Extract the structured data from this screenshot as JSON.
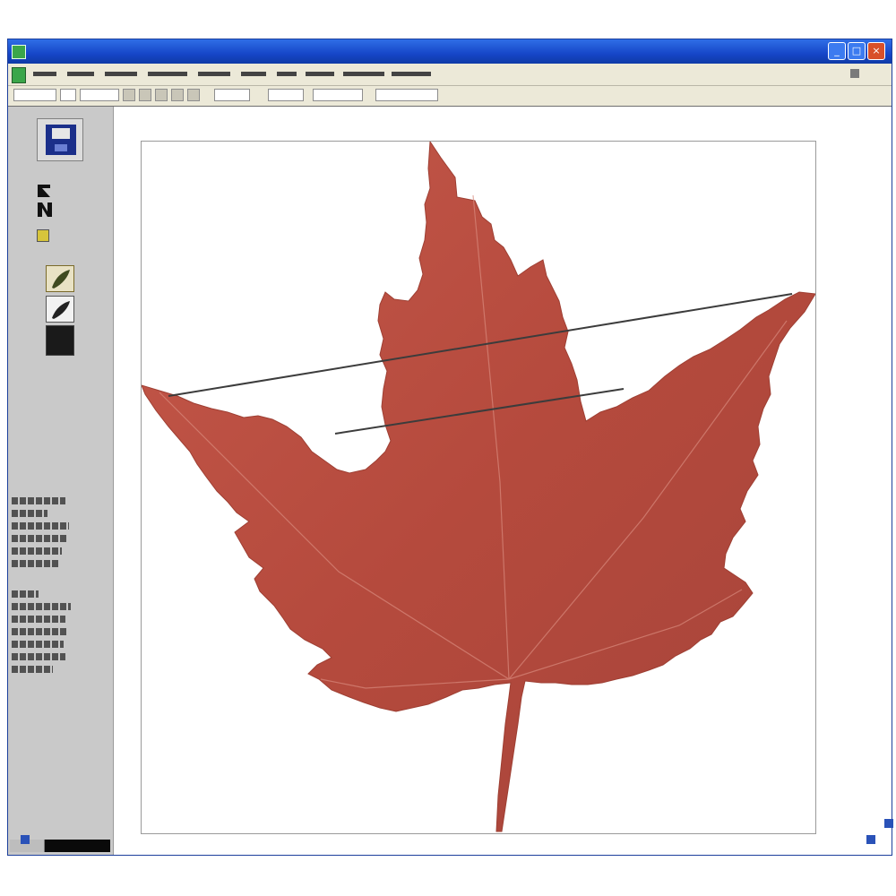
{
  "window": {
    "title": "",
    "accent_color": "#1646c8",
    "icons": {
      "app": "app-icon",
      "minimize": "minimize-icon",
      "maximize": "maximize-icon",
      "close": "close-icon"
    }
  },
  "menubar": {
    "items": [
      "",
      "",
      "",
      "",
      "",
      "",
      "",
      "",
      "",
      ""
    ]
  },
  "leftpanel": {
    "tools": [
      {
        "name": "save",
        "icon": "floppy-disk-icon"
      },
      {
        "name": "text-tool",
        "icon": "text-n-icon"
      },
      {
        "name": "small-tool",
        "icon": "small-yellow-tool-icon"
      },
      {
        "name": "leaf-tool-1",
        "icon": "leaf-brush-icon"
      },
      {
        "name": "leaf-tool-2",
        "icon": "leaf-pen-icon"
      },
      {
        "name": "color-swatch",
        "icon": "black-swatch-icon",
        "color": "#1a1a1a"
      }
    ]
  },
  "canvas": {
    "image": "red-maple-leaf",
    "leaf_color": "#b84a3e",
    "line_color": "#3c3c3c"
  }
}
